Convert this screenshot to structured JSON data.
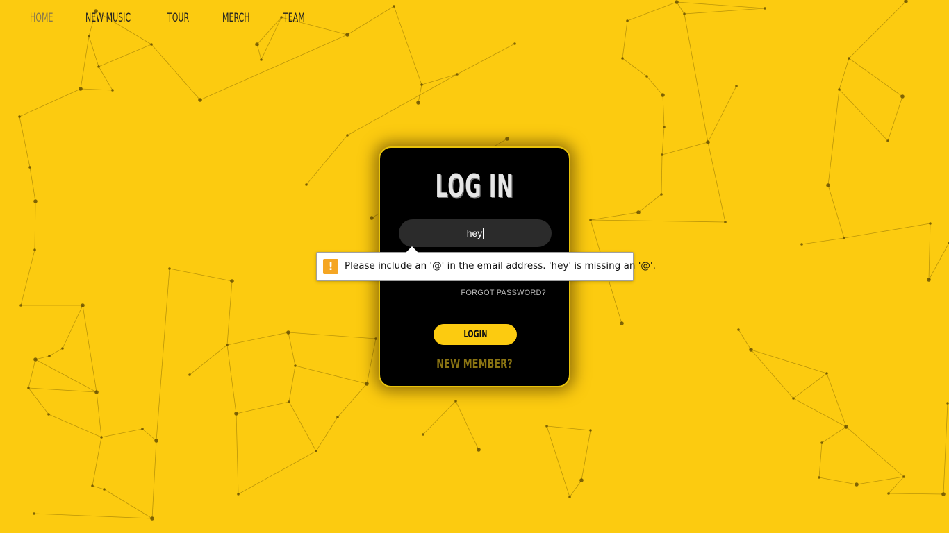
{
  "nav": {
    "items": [
      {
        "label": "HOME",
        "active": true
      },
      {
        "label": "NEW MUSIC"
      },
      {
        "label": "TOUR"
      },
      {
        "label": "MERCH"
      },
      {
        "label": "TEAM"
      }
    ]
  },
  "login": {
    "title": "LOG IN",
    "email_value": "hey",
    "forgot_label": "FORGOT PASSWORD?",
    "submit_label": "LOGIN",
    "new_member_label": "NEW MEMBER?"
  },
  "validation": {
    "icon": "warning-icon",
    "message": "Please include an '@' in the email address. 'hey' is missing an '@'."
  },
  "colors": {
    "background": "#fccb10",
    "card": "#000000",
    "accent": "#fccb10",
    "new_member": "#8a7412"
  }
}
